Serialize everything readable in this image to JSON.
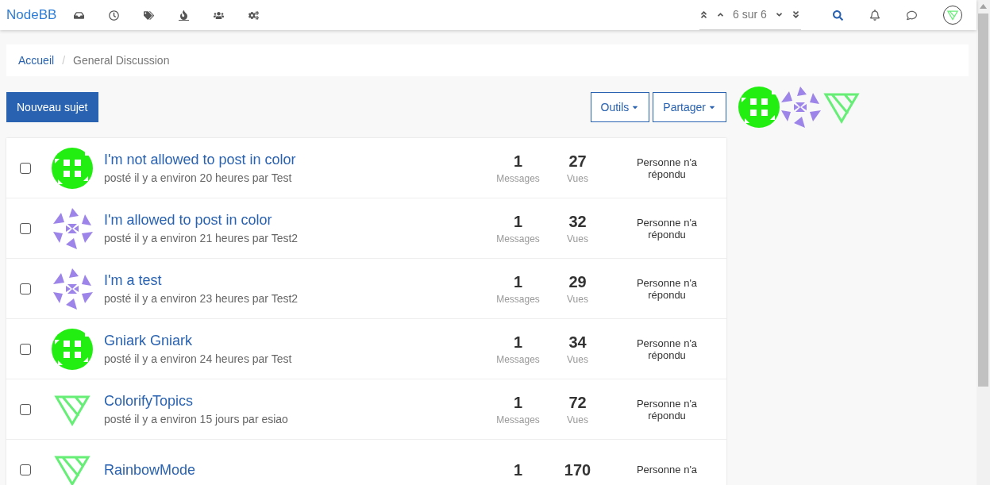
{
  "brand": "NodeBB",
  "pagination": "6 sur 6",
  "breadcrumb": [
    {
      "label": "Accueil",
      "link": true
    },
    {
      "label": "General Discussion",
      "link": false
    }
  ],
  "breadcrumb_separator": "/",
  "new_topic_button": "Nouveau sujet",
  "tool_buttons": [
    "Outils",
    "Partager"
  ],
  "participants": [
    {
      "kind": "quilt"
    },
    {
      "kind": "star"
    },
    {
      "kind": "triangle"
    }
  ],
  "topics": [
    {
      "title": "I'm not allowed to post in color",
      "meta": "posté il y a environ 20 heures par Test",
      "avatar": {
        "kind": "quilt"
      },
      "checked": false,
      "posts": "1",
      "posts_label": "Messages",
      "views": "27",
      "views_label": "Vues",
      "reply": "Personne n'a répondu"
    },
    {
      "title": "I'm allowed to post in color",
      "meta": "posté il y a environ 21 heures par Test2",
      "avatar": {
        "kind": "star"
      },
      "checked": false,
      "posts": "1",
      "posts_label": "Messages",
      "views": "32",
      "views_label": "Vues",
      "reply": "Personne n'a répondu"
    },
    {
      "title": "I'm a test",
      "meta": "posté il y a environ 23 heures par Test2",
      "avatar": {
        "kind": "star"
      },
      "checked": false,
      "posts": "1",
      "posts_label": "Messages",
      "views": "29",
      "views_label": "Vues",
      "reply": "Personne n'a répondu"
    },
    {
      "title": "Gniark Gniark",
      "meta": "posté il y a environ 24 heures par Test",
      "avatar": {
        "kind": "quilt"
      },
      "checked": false,
      "posts": "1",
      "posts_label": "Messages",
      "views": "34",
      "views_label": "Vues",
      "reply": "Personne n'a répondu"
    },
    {
      "title": "ColorifyTopics",
      "meta": "posté il y a environ 15 jours par esiao",
      "avatar": {
        "kind": "triangle"
      },
      "checked": false,
      "posts": "1",
      "posts_label": "Messages",
      "views": "72",
      "views_label": "Vues",
      "reply": "Personne n'a répondu"
    },
    {
      "title": "RainbowMode",
      "avatar": {
        "kind": "triangle"
      },
      "checked": false,
      "posts": "1",
      "views": "170",
      "reply": "Personne n'a"
    }
  ]
}
